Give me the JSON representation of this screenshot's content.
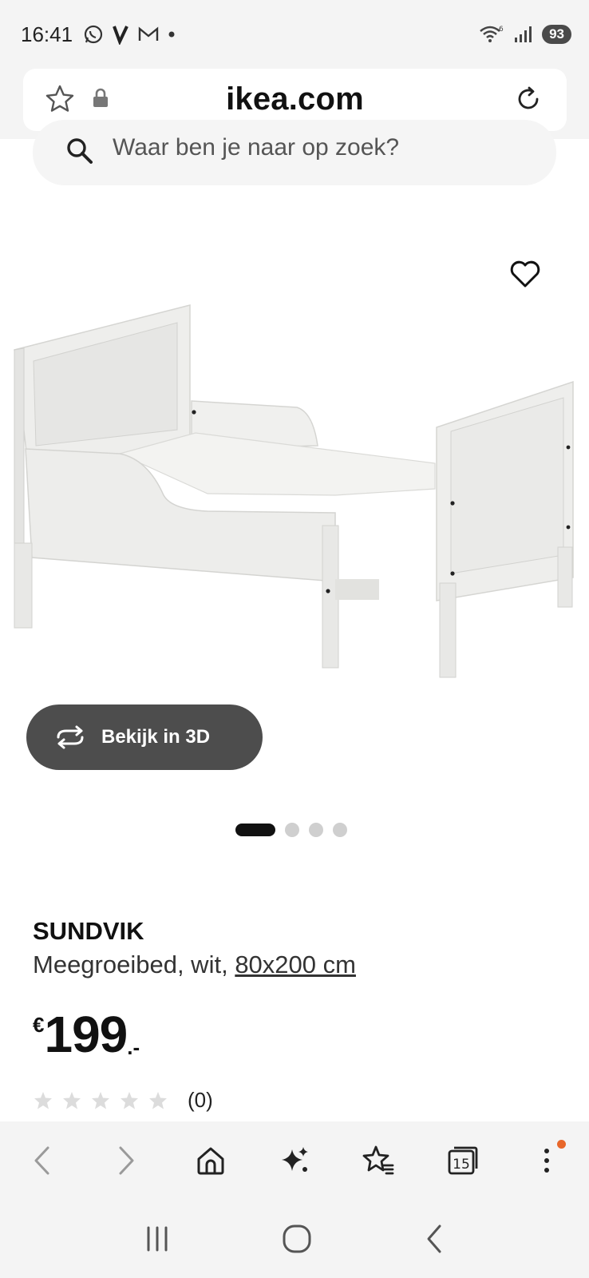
{
  "status_bar": {
    "time": "16:41",
    "left_icons": [
      "whatsapp-icon",
      "v-app-icon",
      "gmail-icon",
      "dot-icon"
    ],
    "right_icons": [
      "wifi-icon",
      "signal-icon"
    ],
    "battery": "93"
  },
  "browser": {
    "url": "ikea.com"
  },
  "search": {
    "placeholder": "Waar ben je naar op zoek?"
  },
  "product": {
    "view_3d_label": "Bekijk in 3D",
    "carousel_total": 4,
    "carousel_active": 1,
    "name": "SUNDVIK",
    "description": "Meegroeibed, wit, ",
    "size": "80x200 cm",
    "price_currency": "€",
    "price_value": "199",
    "price_suffix": ".-",
    "rating_stars": 0,
    "rating_max": 5,
    "rating_count": "(0)"
  },
  "toolbar": {
    "items": [
      "back-icon",
      "forward-icon",
      "home-icon",
      "ai-sparkle-icon",
      "bookmarks-icon",
      "tabs-icon",
      "menu-icon"
    ],
    "tabs_count": "15",
    "accent_color": "#e8672a"
  },
  "navbar": {
    "items": [
      "recent-apps-icon",
      "home-circle-icon",
      "back-icon"
    ]
  }
}
